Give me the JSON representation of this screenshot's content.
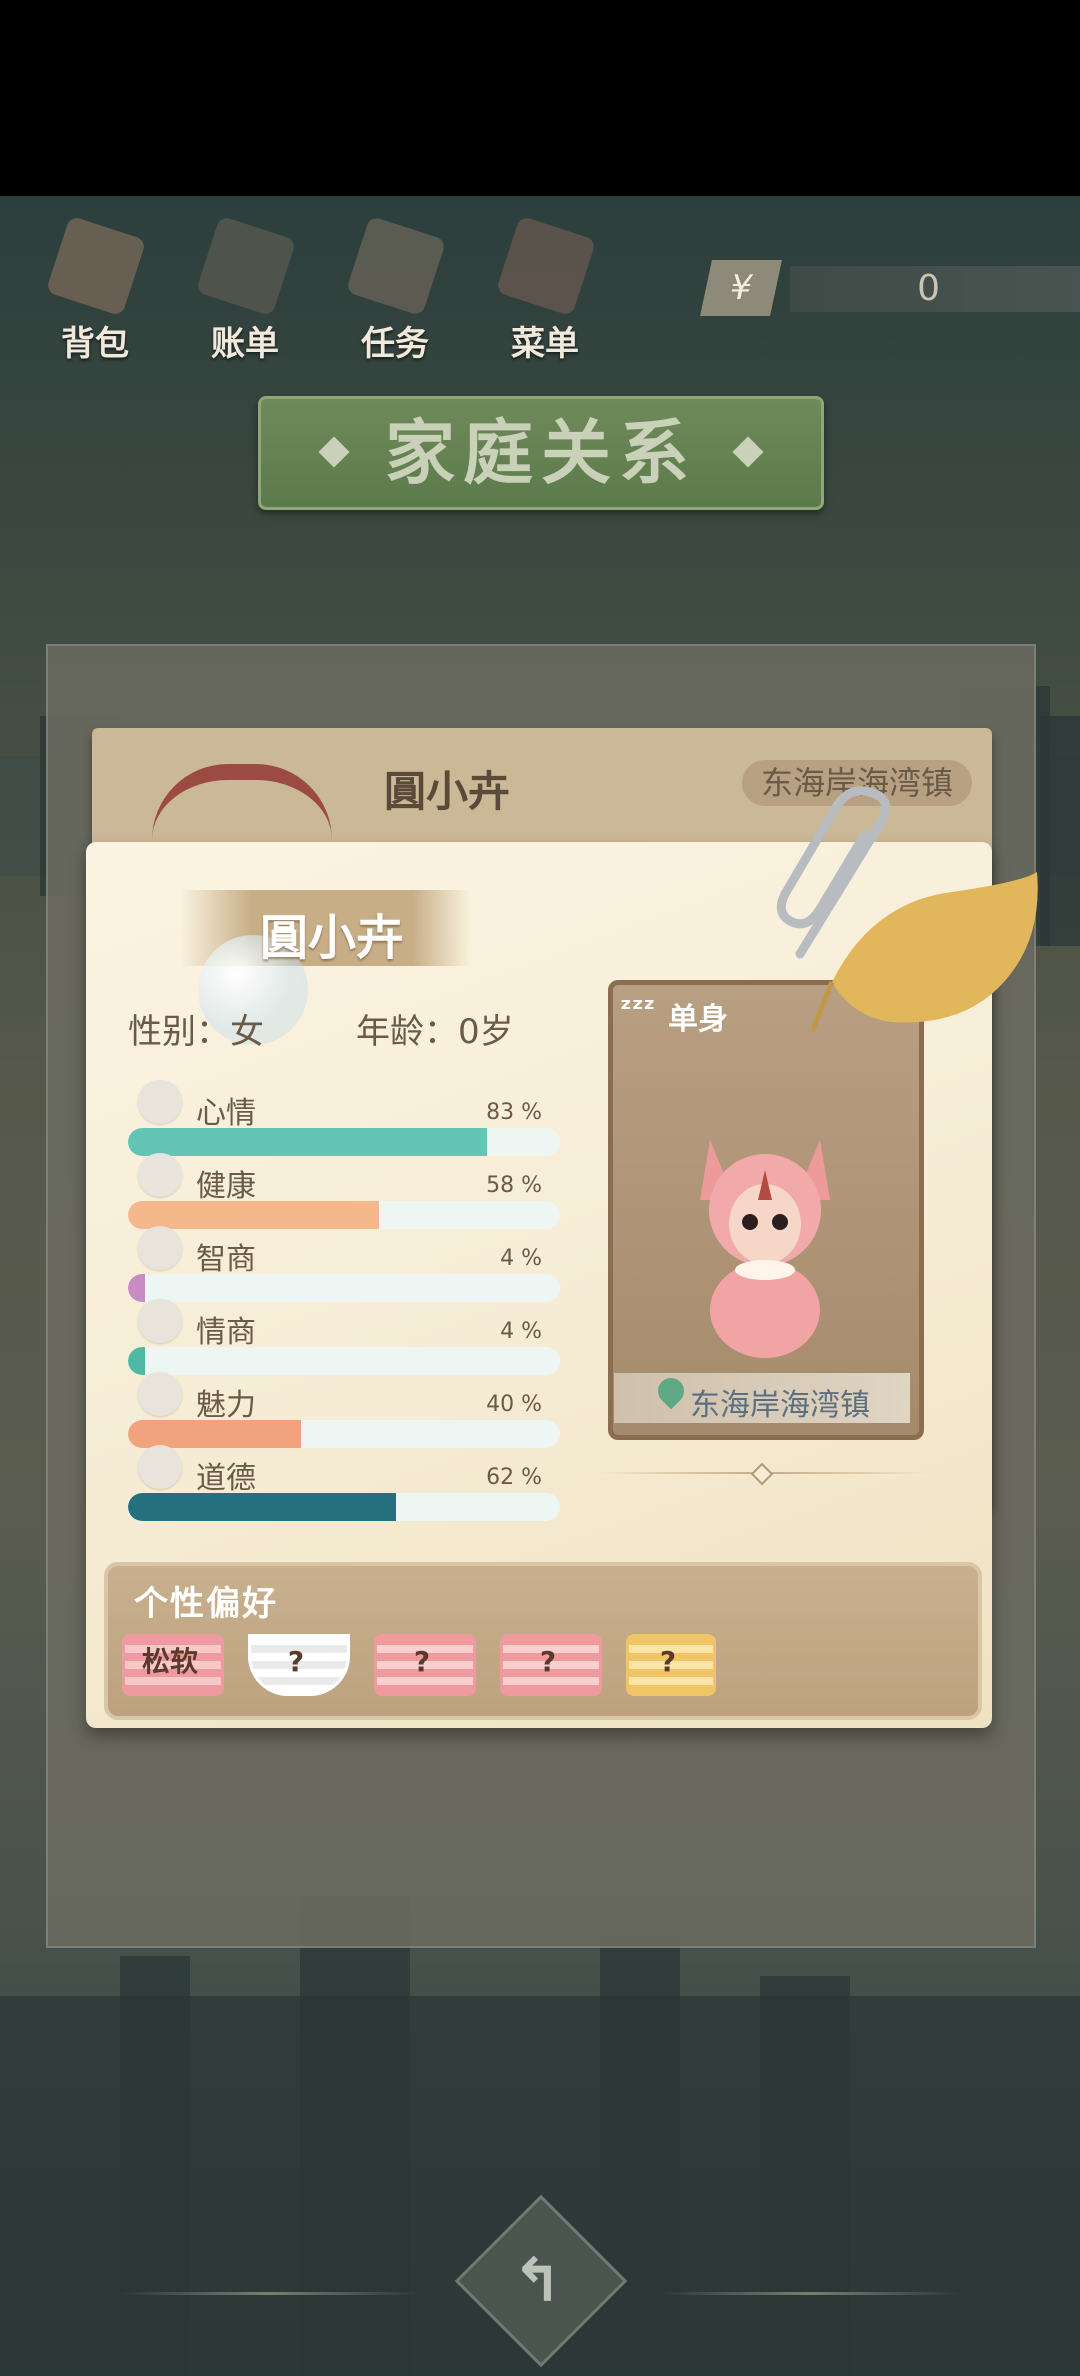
{
  "topbar": {
    "items": [
      {
        "label": "背包",
        "icon": "bag-icon"
      },
      {
        "label": "账单",
        "icon": "bill-icon"
      },
      {
        "label": "任务",
        "icon": "task-icon"
      },
      {
        "label": "菜单",
        "icon": "menu-icon"
      }
    ],
    "money": {
      "currency_symbol": "¥",
      "value": "0"
    }
  },
  "page_title": "家庭关系",
  "back_card": {
    "name": "圓小卉",
    "location": "东海岸海湾镇"
  },
  "profile": {
    "name": "圓小卉",
    "gender_label": "性别：女",
    "age_label": "年龄：0岁",
    "stats": [
      {
        "label": "心情",
        "percent": 83,
        "percent_text": "83 %",
        "color": "#63c6b5",
        "icon": "smile-icon"
      },
      {
        "label": "健康",
        "percent": 58,
        "percent_text": "58 %",
        "color": "#f4b88a",
        "icon": "heart-icon"
      },
      {
        "label": "智商",
        "percent": 4,
        "percent_text": "4 %",
        "color": "#c98bc6",
        "icon": "lightbulb-icon"
      },
      {
        "label": "情商",
        "percent": 4,
        "percent_text": "4 %",
        "color": "#4fb9a4",
        "icon": "apple-icon"
      },
      {
        "label": "魅力",
        "percent": 40,
        "percent_text": "40 %",
        "color": "#f0a37c",
        "icon": "sparkle-icon"
      },
      {
        "label": "道德",
        "percent": 62,
        "percent_text": "62 %",
        "color": "#25707f",
        "icon": "scales-icon"
      }
    ]
  },
  "character_card": {
    "status": "单身",
    "status_icon": "zzz-icon",
    "location": "东海岸海湾镇"
  },
  "preferences": {
    "title": "个性偏好",
    "items": [
      {
        "label": "松软",
        "icon": "pillow-icon",
        "colors": [
          "#ef9aa0",
          "#f8c7c7"
        ]
      },
      {
        "label": "?",
        "icon": "teacup-icon",
        "colors": [
          "#ffffff",
          "#eaeaea"
        ]
      },
      {
        "label": "?",
        "icon": "pillow-icon",
        "colors": [
          "#f09a9e",
          "#f8d0cf"
        ]
      },
      {
        "label": "?",
        "icon": "pillow-icon",
        "colors": [
          "#f09a9e",
          "#f8d0cf"
        ]
      },
      {
        "label": "?",
        "icon": "beer-mug-icon",
        "colors": [
          "#f1c466",
          "#fbe3a8"
        ]
      }
    ]
  },
  "colors": {
    "accent_green": "#6f8a5a",
    "card_bg": "#f6ecd4",
    "frame": "#8b6e52"
  }
}
